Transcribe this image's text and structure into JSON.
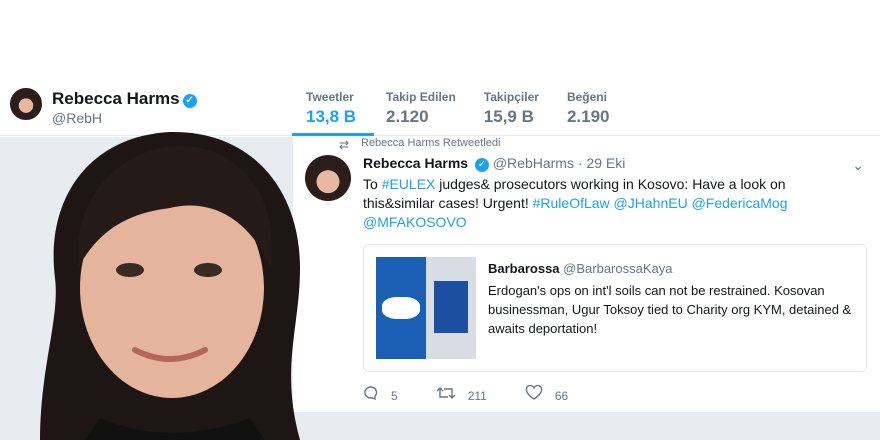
{
  "profile": {
    "name": "Rebecca Harms",
    "handle": "@RebH"
  },
  "stats": [
    {
      "label": "Tweetler",
      "value": "13,8 B",
      "active": true
    },
    {
      "label": "Takip Edilen",
      "value": "2.120"
    },
    {
      "label": "Takipçiler",
      "value": "15,9 B"
    },
    {
      "label": "Beğeni",
      "value": "2.190"
    }
  ],
  "tweet": {
    "retweet_label": "Rebecca Harms Retweetledi",
    "name": "Rebecca Harms",
    "handle": "@RebHarms",
    "date": "· 29 Eki",
    "text_parts": {
      "p1": "To ",
      "tag1": "#EULEX",
      "p2": " judges& prosecutors working in Kosovo: Have a look on this&similar cases! Urgent! ",
      "tag2": "#RuleOfLaw",
      "p3": " ",
      "tag3": "@JHahnEU",
      "p4": " ",
      "tag4": "@FedericaMog",
      "p5": " ",
      "tag5": "@MFAKOSOVO"
    },
    "quote": {
      "name": "Barbarossa",
      "handle": "@BarbarossaKaya",
      "text": "Erdogan's ops on int'l soils can not be restrained. Kosovan businessman, Ugur Toksoy tied to Charity org KYM, detained & awaits deportation!"
    },
    "actions": {
      "replies": "5",
      "retweets": "211",
      "likes": "66"
    }
  },
  "icons": {
    "verified": "verified-badge-icon",
    "retweet": "retweet-icon",
    "reply": "reply-icon",
    "like": "heart-icon",
    "chevron": "chevron-down-icon"
  },
  "colors": {
    "accent": "#1da1f2",
    "muted": "#657786",
    "background": "#e6ecf0"
  }
}
